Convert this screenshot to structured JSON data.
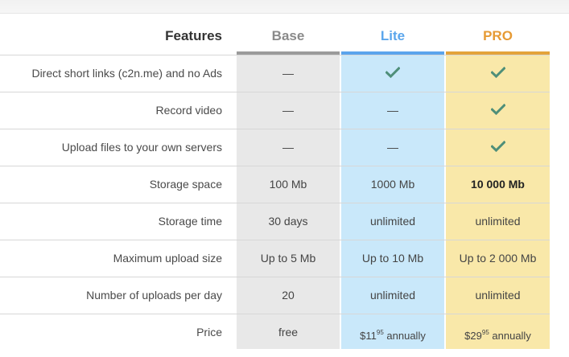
{
  "colors": {
    "base_bg": "#e8e8e8",
    "lite_bg": "#c9e8fa",
    "pro_bg": "#f9e8a9",
    "base_accent": "#9b9b9b",
    "lite_accent": "#5ba4ec",
    "pro_accent": "#e3a33b",
    "check_color": "#4f8f79"
  },
  "header": {
    "features": "Features",
    "base": "Base",
    "lite": "Lite",
    "pro": "PRO"
  },
  "rows": [
    {
      "feature": "Direct short links (c2n.me) and no Ads",
      "base": "—",
      "lite": "check-icon",
      "pro": "check-icon"
    },
    {
      "feature": "Record video",
      "base": "—",
      "lite": "—",
      "pro": "check-icon"
    },
    {
      "feature": "Upload files to your own servers",
      "base": "—",
      "lite": "—",
      "pro": "check-icon"
    },
    {
      "feature": "Storage space",
      "base": "100 Mb",
      "lite": "1000 Mb",
      "pro": "10 000 Mb"
    },
    {
      "feature": "Storage time",
      "base": "30 days",
      "lite": "unlimited",
      "pro": "unlimited"
    },
    {
      "feature": "Maximum upload size",
      "base": "Up to 5 Mb",
      "lite": "Up to 10 Mb",
      "pro": "Up to 2 000 Mb"
    },
    {
      "feature": "Number of uploads per day",
      "base": "20",
      "lite": "unlimited",
      "pro": "unlimited"
    },
    {
      "feature": "Price",
      "base": "free",
      "lite": "$11",
      "pro": "$29"
    }
  ],
  "price": {
    "lite": {
      "amount": "$11",
      "cents": "95",
      "period": " annually"
    },
    "pro": {
      "amount": "$29",
      "cents": "95",
      "period": " annually"
    }
  }
}
